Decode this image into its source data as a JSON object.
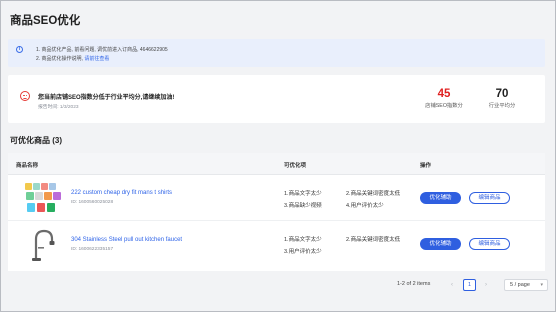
{
  "page": {
    "title": "商品SEO优化"
  },
  "notice": {
    "line1": "1. 商品优化产品, 前看问题, 调优前进入订商品, 4646622905",
    "line2_prefix": "2. 商品优化操作说明,",
    "line2_link": "请前往查看"
  },
  "score": {
    "message": "您当前店铺SEO指数分低于行业平均分,请继续加油!",
    "date": "报告时间: 1/3/2023",
    "store_value": "45",
    "store_label": "店铺SEO指数分",
    "industry_value": "70",
    "industry_label": "行业平均分",
    "store_color": "#e02020"
  },
  "section": {
    "title": "可优化商品 (3)"
  },
  "table": {
    "headers": [
      "商品名称",
      "可优化项",
      "操作"
    ],
    "rows": [
      {
        "name": "222 custom cheap dry fit mans t shirts",
        "id": "ID: 1600560025028",
        "issues": [
          "1.商品文字太少",
          "2.商品关键词密度太低",
          "3.商品缺少视频",
          "4.用户评价太少"
        ]
      },
      {
        "name": "304 Stainless Steel pull out kitchen faucet",
        "id": "ID: 1600622335157",
        "issues": [
          "1.商品文字太少",
          "2.商品关键词密度太低",
          "3.用户评价太少",
          ""
        ]
      }
    ],
    "actions": {
      "primary": "优化辅助",
      "secondary": "编辑商品"
    }
  },
  "pagination": {
    "summary": "1-2 of 2 items",
    "current": "1",
    "page_size": "5 / page"
  },
  "colors": {
    "accent": "#2f5fe0",
    "danger": "#e02020"
  }
}
